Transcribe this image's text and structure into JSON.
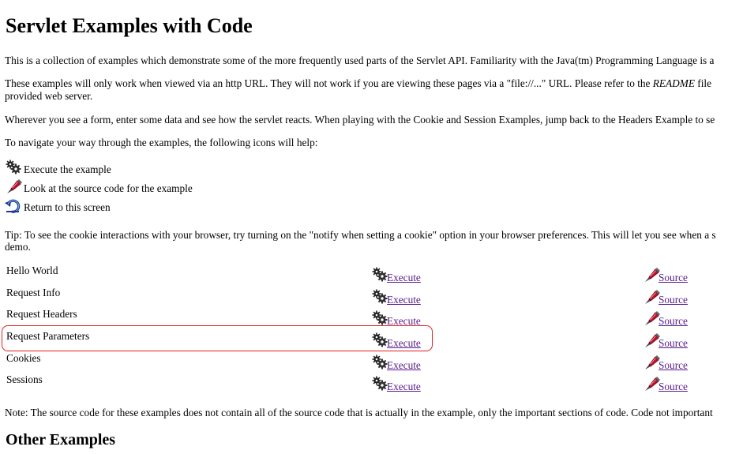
{
  "title": "Servlet Examples with Code",
  "intro": [
    "This is a collection of examples which demonstrate some of the more frequently used parts of the Servlet API. Familiarity with the Java(tm) Programming Language is a",
    "These examples will only work when viewed via an http URL. They will not work if you are viewing these pages via a \"file://...\" URL. Please refer to the",
    "README",
    "file",
    "provided web server.",
    "Wherever you see a form, enter some data and see how the servlet reacts. When playing with the Cookie and Session Examples, jump back to the Headers Example to se",
    "To navigate your way through the examples, the following icons will help:"
  ],
  "legend": [
    {
      "icon": "gear-icon",
      "text": "Execute the example"
    },
    {
      "icon": "pen-icon",
      "text": "Look at the source code for the example"
    },
    {
      "icon": "return-icon",
      "text": "Return to this screen"
    }
  ],
  "tip": [
    "Tip: To see the cookie interactions with your browser, try turning on the \"notify when setting a cookie\" option in your browser preferences. This will let you see when a s",
    "demo."
  ],
  "examples": [
    {
      "name": "Hello World",
      "execute": "Execute",
      "source": "Source"
    },
    {
      "name": "Request Info",
      "execute": "Execute",
      "source": "Source"
    },
    {
      "name": "Request Headers",
      "execute": "Execute",
      "source": "Source"
    },
    {
      "name": "Request Parameters",
      "execute": "Execute",
      "source": "Source"
    },
    {
      "name": "Cookies",
      "execute": "Execute",
      "source": "Source"
    },
    {
      "name": "Sessions",
      "execute": "Execute",
      "source": "Source"
    }
  ],
  "note": "Note: The source code for these examples does not contain all of the source code that is actually in the example, only the important sections of code. Code not important",
  "other_heading": "Other Examples",
  "colors": {
    "link": "#551a8b",
    "highlight": "#e02020"
  }
}
